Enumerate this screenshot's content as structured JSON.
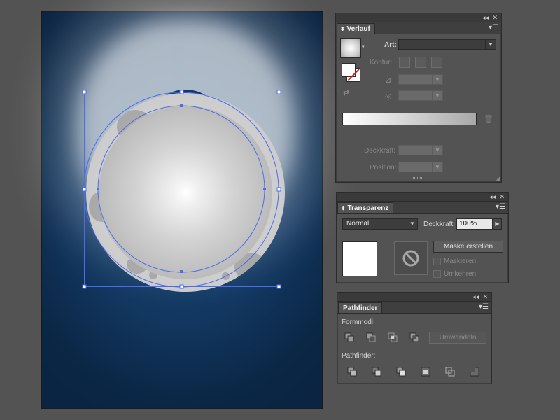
{
  "gradient_panel": {
    "tab_label": "Verlauf",
    "art_label": "Art:",
    "art_value": "",
    "kontur_label": "Kontur:",
    "deckkraft_label": "Deckkraft:",
    "position_label": "Position:",
    "collapse_glyph": "◂◂",
    "close_glyph": "✕",
    "menu_glyph": "▾☰"
  },
  "transparency_panel": {
    "tab_label": "Transparenz",
    "blend_mode_value": "Normal",
    "deckkraft_label": "Deckkraft:",
    "deckkraft_value": "100%",
    "make_mask_label": "Maske erstellen",
    "clip_label": "Maskieren",
    "invert_label": "Umkehren",
    "collapse_glyph": "◂◂",
    "close_glyph": "✕",
    "menu_glyph": "▾☰"
  },
  "pathfinder_panel": {
    "tab_label": "Pathfinder",
    "shape_modes_label": "Formmodi:",
    "expand_label": "Umwandeln",
    "pathfinders_label": "Pathfinder:",
    "collapse_glyph": "◂◂",
    "close_glyph": "✕",
    "menu_glyph": "▾☰"
  },
  "colors": {
    "artboard_bg": "#0b2746",
    "selection": "#4a6cf0",
    "panel_bg": "#535353",
    "workspace_bg": "#535353"
  }
}
